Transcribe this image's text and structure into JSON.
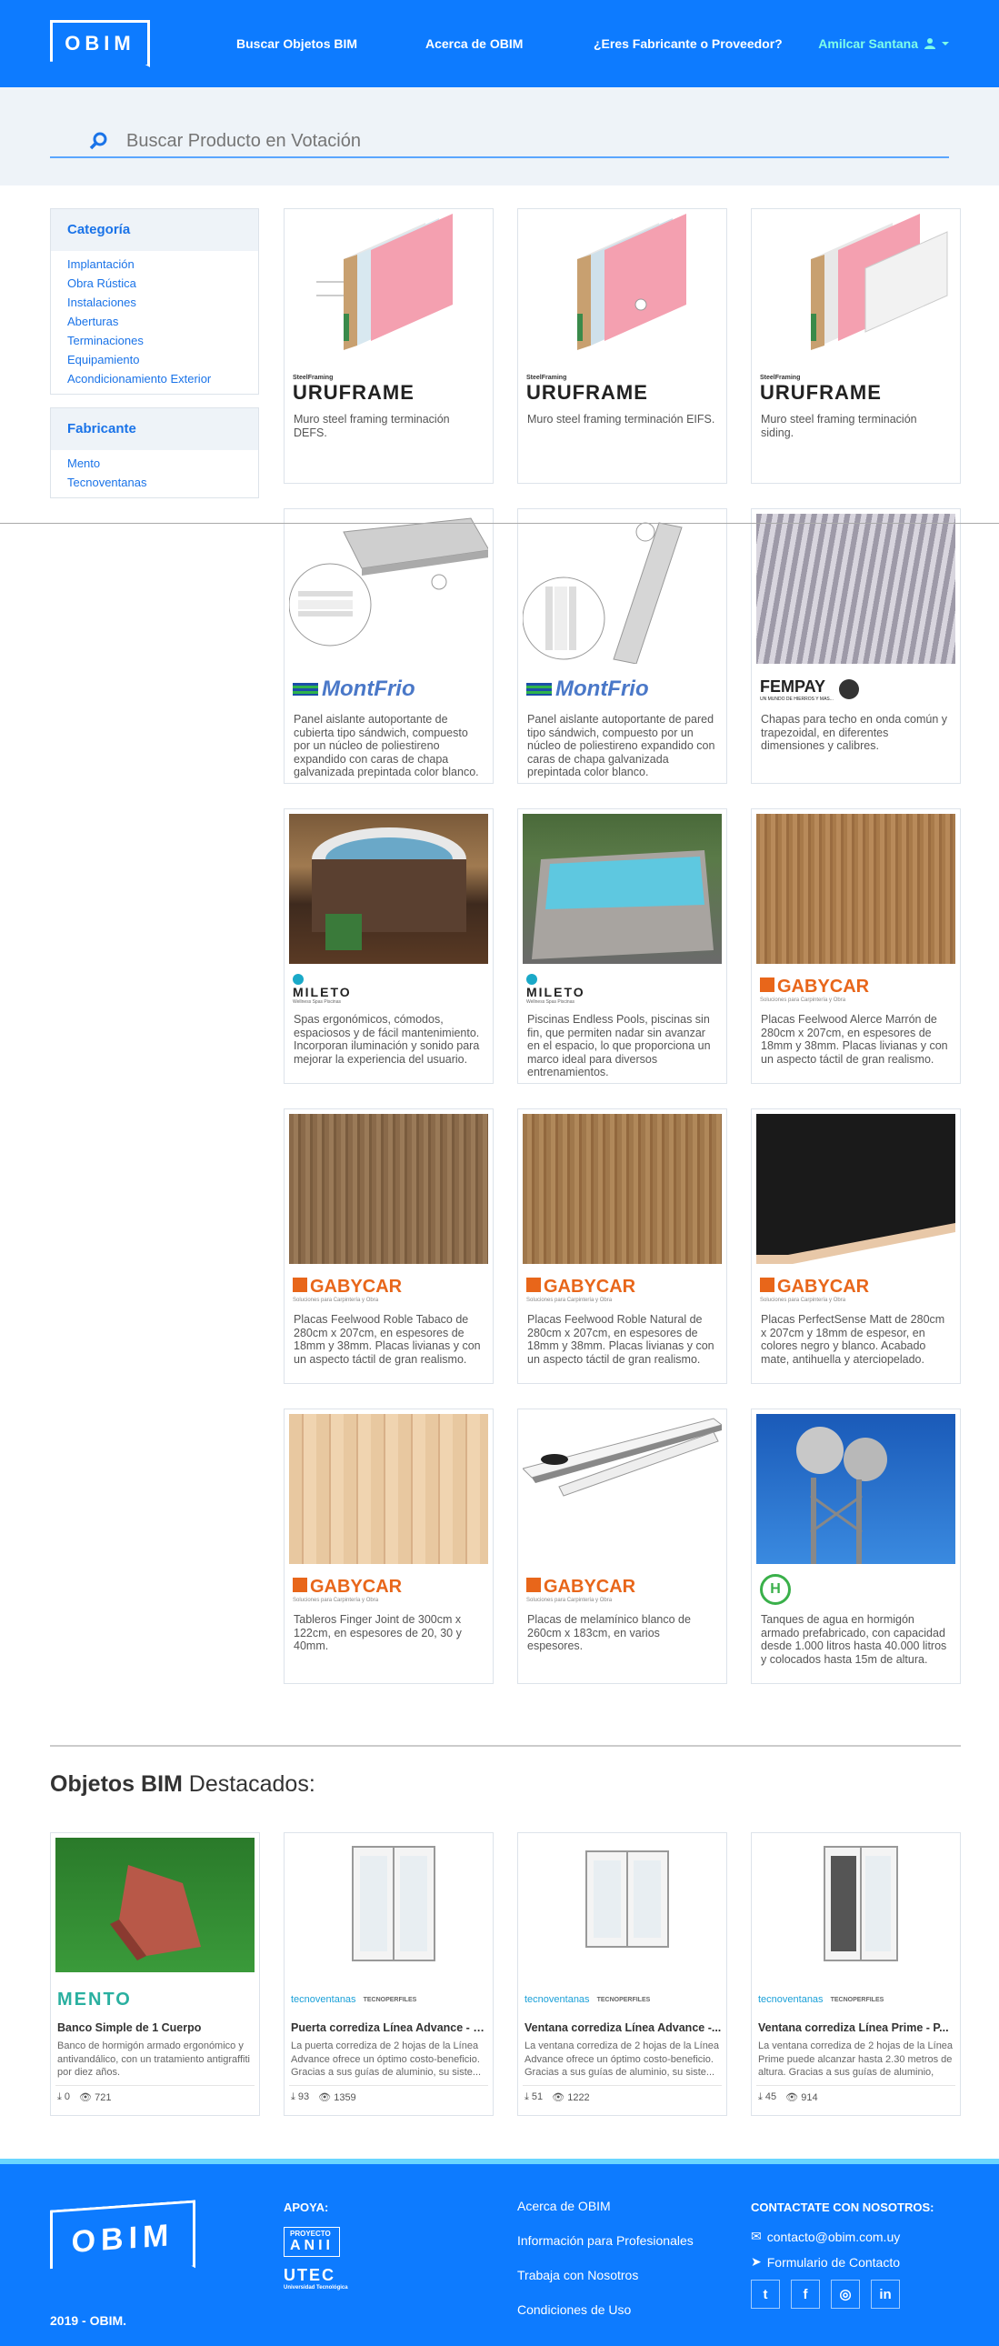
{
  "header": {
    "logo": "OBIM",
    "nav": [
      "Buscar Objetos BIM",
      "Acerca de OBIM",
      "¿Eres Fabricante o Proveedor?"
    ],
    "user": "Amilcar Santana",
    "accent": "#0d7bff"
  },
  "search": {
    "placeholder": "Buscar Producto en Votación"
  },
  "sidebar": {
    "categoria_title": "Categoría",
    "categorias": [
      "Implantación",
      "Obra Rústica",
      "Instalaciones",
      "Aberturas",
      "Terminaciones",
      "Equipamiento",
      "Acondicionamiento Exterior"
    ],
    "fabricante_title": "Fabricante",
    "fabricantes": [
      "Mento",
      "Tecnoventanas"
    ]
  },
  "products": [
    {
      "brand": "URUFRAME",
      "brand_sub": "SteelFraming",
      "desc": "Muro steel framing terminación DEFS."
    },
    {
      "brand": "URUFRAME",
      "brand_sub": "SteelFraming",
      "desc": "Muro steel framing terminación EIFS."
    },
    {
      "brand": "URUFRAME",
      "brand_sub": "SteelFraming",
      "desc": "Muro steel framing terminación siding."
    },
    {
      "brand": "MontFrio",
      "brand_sub": "",
      "desc": "Panel aislante autoportante de cubierta tipo sándwich, compuesto por un núcleo de poliestireno expandido con caras de chapa galvanizada prepintada color blanco."
    },
    {
      "brand": "MontFrio",
      "brand_sub": "",
      "desc": "Panel aislante autoportante de pared tipo sándwich, compuesto por un núcleo de poliestireno expandido con caras de chapa galvanizada prepintada color blanco."
    },
    {
      "brand": "FEMPAY",
      "brand_sub": "UN MUNDO DE HIERROS Y MAS...",
      "desc": "Chapas para techo en onda común y trapezoidal, en diferentes dimensiones y calibres."
    },
    {
      "brand": "MILETO",
      "brand_sub": "Wellness Spas Piscinas",
      "desc": "Spas ergonómicos, cómodos, espaciosos y de fácil mantenimiento. Incorporan iluminación y sonido para mejorar la experiencia del usuario."
    },
    {
      "brand": "MILETO",
      "brand_sub": "Wellness Spas Piscinas",
      "desc": "Piscinas Endless Pools, piscinas sin fin, que permiten nadar sin avanzar en el espacio, lo que proporciona un marco ideal para diversos entrenamientos."
    },
    {
      "brand": "GABYCAR",
      "brand_sub": "Soluciones para Carpintería y Obra",
      "desc": "Placas Feelwood Alerce Marrón de 280cm x 207cm, en espesores de 18mm y 38mm. Placas livianas y con un aspecto táctil de gran realismo."
    },
    {
      "brand": "GABYCAR",
      "brand_sub": "Soluciones para Carpintería y Obra",
      "desc": "Placas Feelwood Roble Tabaco de 280cm x 207cm, en espesores de 18mm y 38mm. Placas livianas y con un aspecto táctil de gran realismo."
    },
    {
      "brand": "GABYCAR",
      "brand_sub": "Soluciones para Carpintería y Obra",
      "desc": "Placas Feelwood Roble Natural de 280cm x 207cm, en espesores de 18mm y 38mm. Placas livianas y con un aspecto táctil de gran realismo."
    },
    {
      "brand": "GABYCAR",
      "brand_sub": "Soluciones para Carpintería y Obra",
      "desc": "Placas PerfectSense Matt de 280cm x 207cm y 18mm de espesor, en colores negro y blanco. Acabado mate, antihuella y aterciopelado."
    },
    {
      "brand": "GABYCAR",
      "brand_sub": "Soluciones para Carpintería y Obra",
      "desc": "Tableros Finger Joint de 300cm x 122cm, en espesores de 20, 30 y 40mm."
    },
    {
      "brand": "GABYCAR",
      "brand_sub": "Soluciones para Carpintería y Obra",
      "desc": "Placas de melamínico blanco de 260cm x 183cm, en varios espesores."
    },
    {
      "brand": "H",
      "brand_sub": "",
      "desc": "Tanques de agua en hormigón armado prefabricado, con capacidad desde 1.000 litros hasta 40.000 litros y colocados hasta 15m de altura."
    }
  ],
  "featured": {
    "title_bold": "Objetos BIM",
    "title_rest": "Destacados:",
    "items": [
      {
        "brand": "MENTO",
        "title": "Banco Simple de 1 Cuerpo",
        "desc": "Banco de hormigón armado ergonómico y antivandálico, con un tratamiento antigraffiti por diez años.",
        "downloads": "0",
        "views": "721"
      },
      {
        "brand": "tecnoventanas",
        "brand2": "TECNOPERFILES",
        "title": "Puerta corrediza Línea Advance - P...",
        "desc": "La puerta corrediza de 2 hojas de la Línea Advance ofrece un óptimo costo-beneficio. Gracias a sus guías de aluminio, su siste...",
        "downloads": "93",
        "views": "1359"
      },
      {
        "brand": "tecnoventanas",
        "brand2": "TECNOPERFILES",
        "title": "Ventana corrediza Línea Advance -...",
        "desc": "La ventana corrediza de 2 hojas de la Línea Advance ofrece un óptimo costo-beneficio. Gracias a sus guías de aluminio, su siste...",
        "downloads": "51",
        "views": "1222"
      },
      {
        "brand": "tecnoventanas",
        "brand2": "TECNOPERFILES",
        "title": "Ventana corrediza Línea Prime - P...",
        "desc": "La ventana corrediza de 2 hojas de la Línea Prime puede alcanzar hasta 2.30 metros de altura. Gracias a sus guías de aluminio, su...",
        "downloads": "45",
        "views": "914"
      }
    ]
  },
  "footer": {
    "logo": "OBIM",
    "copyright": "2019 - OBIM.",
    "apoya": "APOYA:",
    "apoya_logo1_top": "PROYECTO",
    "apoya_logo1": "ANII",
    "apoya_logo2": "UTEC",
    "apoya_logo2_sub": "Universidad Tecnológica",
    "links": [
      "Acerca de OBIM",
      "Información para Profesionales",
      "Trabaja con Nosotros",
      "Condiciones de Uso"
    ],
    "contact_title": "CONTACTATE CON NOSOTROS:",
    "email": "contacto@obim.com.uy",
    "form": "Formulario de Contacto"
  }
}
